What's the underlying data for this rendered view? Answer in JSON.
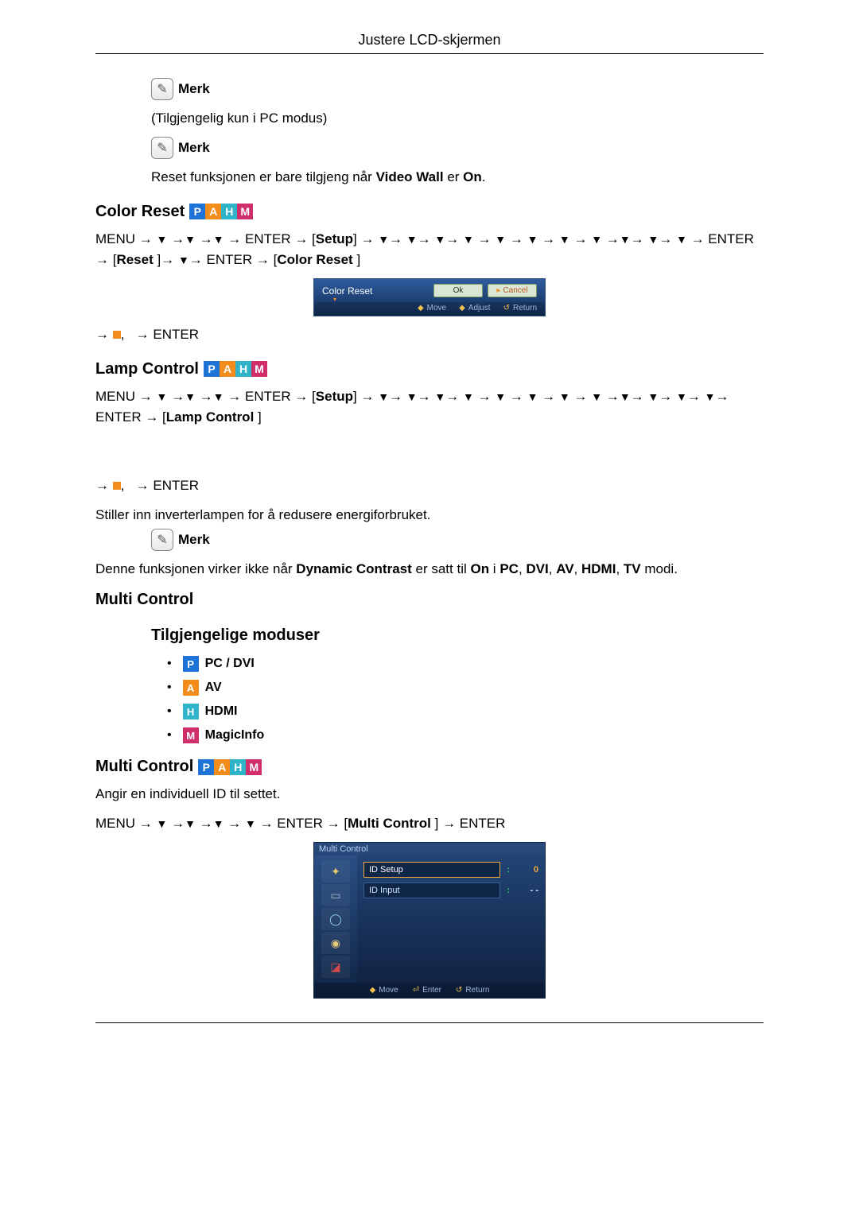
{
  "header": {
    "title": "Justere LCD-skjermen"
  },
  "labels": {
    "merk": "Merk",
    "enter": "ENTER",
    "menu": "MENU",
    "setup": "Setup",
    "reset": "Reset",
    "colorReset": "Color Reset",
    "lampControl": "Lamp Control",
    "multiControl": "Multi Control"
  },
  "notes": {
    "pcOnly": "(Tilgjengelig kun i PC modus)",
    "resetOnlyWhen": "Reset funksjonen er bare tilgjeng når Video Wall er On.",
    "lampDesc": "Stiller inn inverterlampen for å redusere energiforbruket.",
    "lampNote": "Denne funksjonen virker ikke når Dynamic Contrast er satt til On i PC, DVI, AV, HDMI, TV modi.",
    "multiDesc": "Angir en individuell ID til settet."
  },
  "sections": {
    "colorReset": "Color Reset",
    "lampControl": "Lamp Control",
    "multiControl": "Multi Control",
    "multiControl2": "Multi Control",
    "availableModes": "Tilgjengelige moduser"
  },
  "nav": {
    "colorReset": "MENU → ▼ →▼ →▼ → ENTER → [Setup] → ▼→ ▼→ ▼→ ▼ → ▼ → ▼ → ▼ → ▼ →▼→ ▼→ ▼ → ENTER → [Reset ]→ ▼→ ENTER → [Color Reset ]",
    "afterColorReset": "→ ◧,   → ENTER",
    "lampControl": "MENU → ▼ →▼ →▼ → ENTER → [Setup] → ▼→ ▼→ ▼→ ▼ → ▼ → ▼ → ▼ → ▼ →▼→ ▼→ ▼→ ▼→ ENTER → [Lamp Control ]",
    "afterLamp": "→ ◧,   → ENTER",
    "multiControl": "MENU → ▼ →▼ →▼ → ▼ → ENTER → [Multi Control ] → ENTER"
  },
  "osd": {
    "colorReset": {
      "title": "Color Reset",
      "ok": "Ok",
      "cancel": "Cancel",
      "hints": {
        "move": "Move",
        "adjust": "Adjust",
        "return": "Return"
      }
    },
    "multi": {
      "head": "Multi Control",
      "idSetup": "ID  Setup",
      "idInput": "ID  Input",
      "valSetup": "0",
      "valInput": "- -",
      "hints": {
        "move": "Move",
        "enter": "Enter",
        "return": "Return"
      }
    }
  },
  "modes": {
    "pcdvi": "PC / DVI",
    "av": "AV",
    "hdmi": "HDMI",
    "magicinfo": "MagicInfo"
  }
}
